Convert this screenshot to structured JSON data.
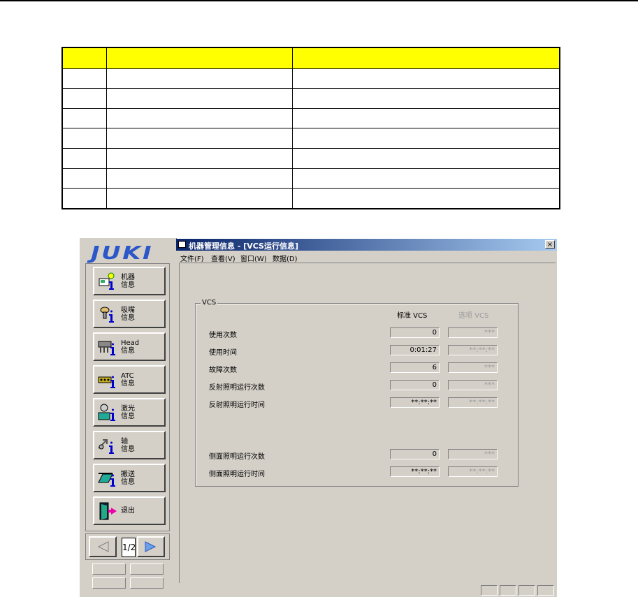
{
  "brand": {
    "logo": "JUKI"
  },
  "sidebar": {
    "buttons": [
      {
        "label": "机器\n信息",
        "icon": "machine-info-icon"
      },
      {
        "label": "吸嘴\n信息",
        "icon": "nozzle-info-icon"
      },
      {
        "label": "Head\n信息",
        "icon": "head-info-icon"
      },
      {
        "label": "ATC\n信息",
        "icon": "atc-info-icon"
      },
      {
        "label": "激光\n信息",
        "icon": "laser-info-icon"
      },
      {
        "label": "轴\n信息",
        "icon": "axis-info-icon"
      },
      {
        "label": "搬送\n信息",
        "icon": "conveyor-info-icon"
      },
      {
        "label": "退出",
        "icon": "exit-door-icon"
      }
    ],
    "page_indicator": "1/2"
  },
  "window": {
    "title": "机器管理信息 - [VCS运行信息]",
    "close": "×",
    "menu": [
      "文件(F)",
      "查看(V)",
      "窗口(W)",
      "数据(D)"
    ],
    "group_title": "VCS",
    "col_standard": "标准 VCS",
    "col_option": "选项 VCS",
    "rows": [
      {
        "label": "使用次数",
        "standard": "0",
        "option": "***"
      },
      {
        "label": "使用时间",
        "standard": "0:01:27",
        "option": "**:**:**"
      },
      {
        "label": "故障次数",
        "standard": "6",
        "option": "***"
      },
      {
        "label": "反射照明运行次数",
        "standard": "0",
        "option": "***"
      },
      {
        "label": "反射照明运行时间",
        "standard": "**:**:**",
        "option": "**:**:**"
      },
      {
        "label": "侧面照明运行次数",
        "standard": "0",
        "option": "***"
      },
      {
        "label": "侧面照明运行时间",
        "standard": "**:**:**",
        "option": "**:**:**"
      }
    ]
  },
  "colors": {
    "header_yellow": "#ffff00",
    "titlebar_start": "#0a246a",
    "titlebar_end": "#a6caf0",
    "logo_blue": "#2b57c8"
  }
}
